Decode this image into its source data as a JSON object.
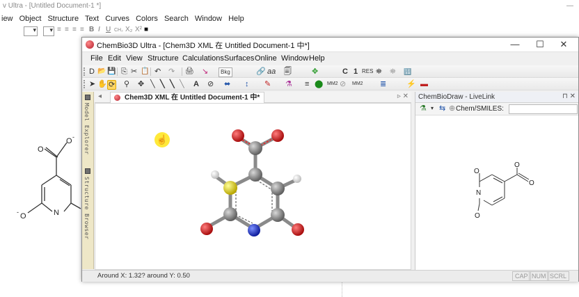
{
  "background_app": {
    "title": "v Ultra - [Untitled Document-1 *]",
    "minimize_glyph": "—",
    "menu": [
      "iew",
      "Object",
      "Structure",
      "Text",
      "Curves",
      "Colors",
      "Search",
      "Window",
      "Help"
    ],
    "format_buttons": [
      "≡",
      "≡",
      "≡",
      "≡",
      "B",
      "I",
      "U",
      "CH₂",
      "X₂",
      "X²",
      "■"
    ],
    "structure_labels": {
      "o_top": "O",
      "o_minus_top": "O",
      "o_left": "O",
      "n_label": "N"
    }
  },
  "window": {
    "title": "ChemBio3D Ultra - [Chem3D XML 在 Untitled Document-1 中*]",
    "controls": {
      "minimize": "—",
      "maximize": "☐",
      "close": "✕"
    },
    "menu": [
      "File",
      "Edit",
      "View",
      "Structure",
      "Calculations",
      "Surfaces",
      "Online",
      "Window",
      "Help"
    ]
  },
  "toolbar1": {
    "items": [
      "D",
      "📂",
      "💾",
      "⎘",
      "✂",
      "📋",
      "↶",
      "↷",
      "🖨",
      "↘",
      "Bkg",
      "🔗",
      "aa",
      "🗐",
      "✥",
      "C",
      "1",
      "RES",
      "⛯",
      "⛯",
      "🔢"
    ]
  },
  "toolbar2": {
    "items": [
      "➤",
      "✋",
      "⟳",
      "⚲",
      "✥",
      "╲",
      "╲",
      "╲",
      "╲",
      "A",
      "⊘",
      "⬌",
      "↕",
      "✎",
      "⚗",
      "≡",
      "⬤",
      "MM2",
      "⊘",
      "MM2",
      "≣",
      "⚡",
      "▬"
    ]
  },
  "side_tabs": {
    "model_explorer": "Model Explorer",
    "structure_browser": "Structure Browser"
  },
  "document": {
    "tab_label": "Chem3D XML 在 Untitled Document-1 中*",
    "nav": "◂",
    "arrows": "▹  ✕"
  },
  "livelink": {
    "title": "ChemBioDraw - LiveLink",
    "pin": "⊓ ✕",
    "smiles_label": "Chem/SMILES:",
    "smiles_value": "",
    "structure_labels": {
      "o_top": "O",
      "o_right": "O",
      "o_right2": "O",
      "o_bottom": "O",
      "n_label": "N"
    }
  },
  "status": {
    "coords": "Around X: 1.32? around Y: 0.50",
    "indicators": [
      "CAP",
      "NUM",
      "SCRL"
    ]
  },
  "colors": {
    "carbon": "#7f7f7f",
    "oxygen": "#d21a1a",
    "nitrogen": "#1a32d2",
    "sulfur": "#e6e61a",
    "hydrogen": "#f2f2f2",
    "highlight": "#ffe93a"
  }
}
